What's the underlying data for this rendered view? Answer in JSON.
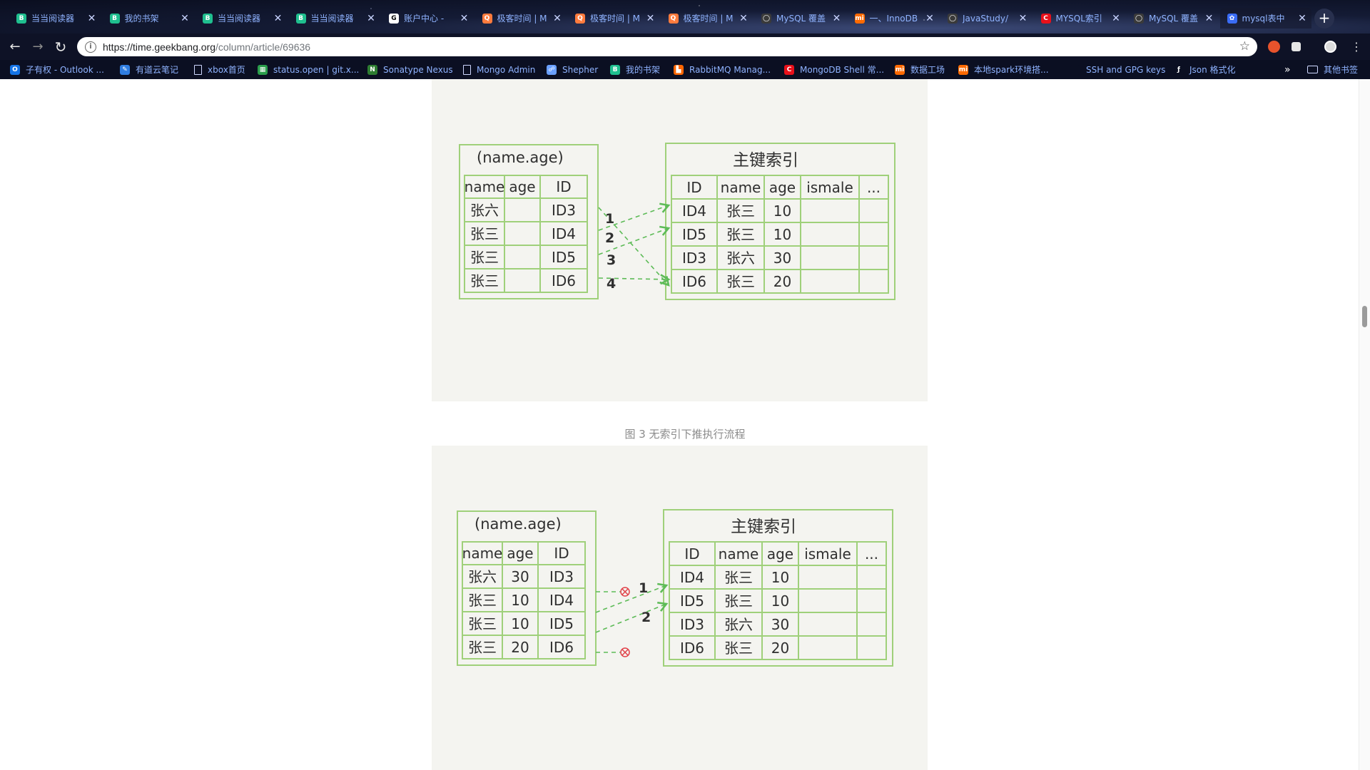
{
  "tabs": [
    {
      "title": "当当阅读器",
      "favicon": "dangdang-icon",
      "color": "#1fbf8f",
      "glyph": "B"
    },
    {
      "title": "我的书架",
      "favicon": "dangdang-icon",
      "color": "#1fbf8f",
      "glyph": "B"
    },
    {
      "title": "当当阅读器",
      "favicon": "dangdang-icon",
      "color": "#1fbf8f",
      "glyph": "B"
    },
    {
      "title": "当当阅读器",
      "favicon": "dangdang-icon",
      "color": "#1fbf8f",
      "glyph": "B"
    },
    {
      "title": "账户中心 - ",
      "favicon": "account-icon",
      "color": "#ffffff",
      "glyph": "G"
    },
    {
      "title": "极客时间 | M",
      "favicon": "geekbang-icon",
      "color": "#ff7b3d",
      "glyph": "Q"
    },
    {
      "title": "极客时间 | M",
      "favicon": "geekbang-icon",
      "color": "#ff7b3d",
      "glyph": "Q"
    },
    {
      "title": "极客时间 | M",
      "favicon": "geekbang-icon",
      "color": "#ff7b3d",
      "glyph": "Q"
    },
    {
      "title": "MySQL 覆盖",
      "favicon": "github-icon",
      "color": "#3a3a3a",
      "glyph": "◯"
    },
    {
      "title": "一、InnoDB",
      "favicon": "mi-icon",
      "color": "#ff6a00",
      "glyph": "mi"
    },
    {
      "title": "JavaStudy/",
      "favicon": "github-icon",
      "color": "#3a3a3a",
      "glyph": "◯"
    },
    {
      "title": "MYSQL索引",
      "favicon": "csdn-icon",
      "color": "#e8101a",
      "glyph": "C"
    },
    {
      "title": "MySQL 覆盖",
      "favicon": "github-icon",
      "color": "#3a3a3a",
      "glyph": "◯"
    },
    {
      "title": "mysql表中",
      "favicon": "baidu-icon",
      "color": "#3a6cf5",
      "glyph": "✿"
    }
  ],
  "active_tab": 13,
  "address": {
    "host": "https://time.geekbang.org",
    "path": "/column/article/69636"
  },
  "bookmarks": [
    {
      "label": "子有权 - Outlook ...",
      "icon": "outlook-icon",
      "color": "#1473e6",
      "glyph": "O"
    },
    {
      "label": "有道云笔记",
      "icon": "youdao-icon",
      "color": "#2f7de1",
      "glyph": "✎"
    },
    {
      "label": "xbox首页",
      "icon": "page-icon",
      "color": "",
      "glyph": ""
    },
    {
      "label": "status.open | git.x...",
      "icon": "sheet-icon",
      "color": "#2a9d4b",
      "glyph": "▦"
    },
    {
      "label": "Sonatype Nexus",
      "icon": "nexus-icon",
      "color": "#2e7d32",
      "glyph": "N"
    },
    {
      "label": "Mongo Admin",
      "icon": "page-icon",
      "color": "",
      "glyph": ""
    },
    {
      "label": "Shepher",
      "icon": "shepher-icon",
      "color": "#6aa0ff",
      "glyph": "☍"
    },
    {
      "label": "我的书架",
      "icon": "dangdang-icon",
      "color": "#1fbf8f",
      "glyph": "B"
    },
    {
      "label": "RabbitMQ Manag...",
      "icon": "rabbitmq-icon",
      "color": "#ff6600",
      "glyph": "▙"
    },
    {
      "label": "MongoDB Shell 常...",
      "icon": "csdn-icon",
      "color": "#e8101a",
      "glyph": "C"
    },
    {
      "label": "数据工场",
      "icon": "mi-icon",
      "color": "#ff6a00",
      "glyph": "mi"
    },
    {
      "label": "本地spark环境搭...",
      "icon": "mi-icon",
      "color": "#ff6a00",
      "glyph": "mi"
    },
    {
      "label": "SSH and GPG keys",
      "icon": "github-icon",
      "color": "#0b0f22",
      "glyph": ""
    },
    {
      "label": "Json 格式化",
      "icon": "json-icon",
      "color": "#0b0f22",
      "glyph": "ƒ"
    }
  ],
  "bookmarks_more": "»",
  "other_bookmarks": "其他书签",
  "new_tab": "+",
  "figure1": {
    "left_title": "(name.age)",
    "left_headers": [
      "name",
      "age",
      "ID"
    ],
    "left_rows": [
      [
        "张六",
        "",
        "ID3"
      ],
      [
        "张三",
        "",
        "ID4"
      ],
      [
        "张三",
        "",
        "ID5"
      ],
      [
        "张三",
        "",
        "ID6"
      ]
    ],
    "right_title": "主键索引",
    "right_headers": [
      "ID",
      "name",
      "age",
      "ismale",
      "..."
    ],
    "right_rows": [
      [
        "ID4",
        "张三",
        "10",
        "",
        ""
      ],
      [
        "ID5",
        "张三",
        "10",
        "",
        ""
      ],
      [
        "ID3",
        "张六",
        "30",
        "",
        ""
      ],
      [
        "ID6",
        "张三",
        "20",
        "",
        ""
      ]
    ],
    "step_labels": [
      "1",
      "2",
      "3",
      "4"
    ]
  },
  "caption": "图 3 无索引下推执行流程",
  "figure2": {
    "left_title": "(name.age)",
    "left_headers": [
      "name",
      "age",
      "ID"
    ],
    "left_rows": [
      [
        "张六",
        "30",
        "ID3"
      ],
      [
        "张三",
        "10",
        "ID4"
      ],
      [
        "张三",
        "10",
        "ID5"
      ],
      [
        "张三",
        "20",
        "ID6"
      ]
    ],
    "right_title": "主键索引",
    "right_headers": [
      "ID",
      "name",
      "age",
      "ismale",
      "..."
    ],
    "right_rows": [
      [
        "ID4",
        "张三",
        "10",
        "",
        ""
      ],
      [
        "ID5",
        "张三",
        "10",
        "",
        ""
      ],
      [
        "ID3",
        "张六",
        "30",
        "",
        ""
      ],
      [
        "ID6",
        "张三",
        "20",
        "",
        ""
      ]
    ],
    "step_labels": [
      "1",
      "2"
    ]
  },
  "colors": {
    "table_border": "#9fd07a",
    "arrow": "#5dbb57",
    "reject": "#e2424a"
  }
}
